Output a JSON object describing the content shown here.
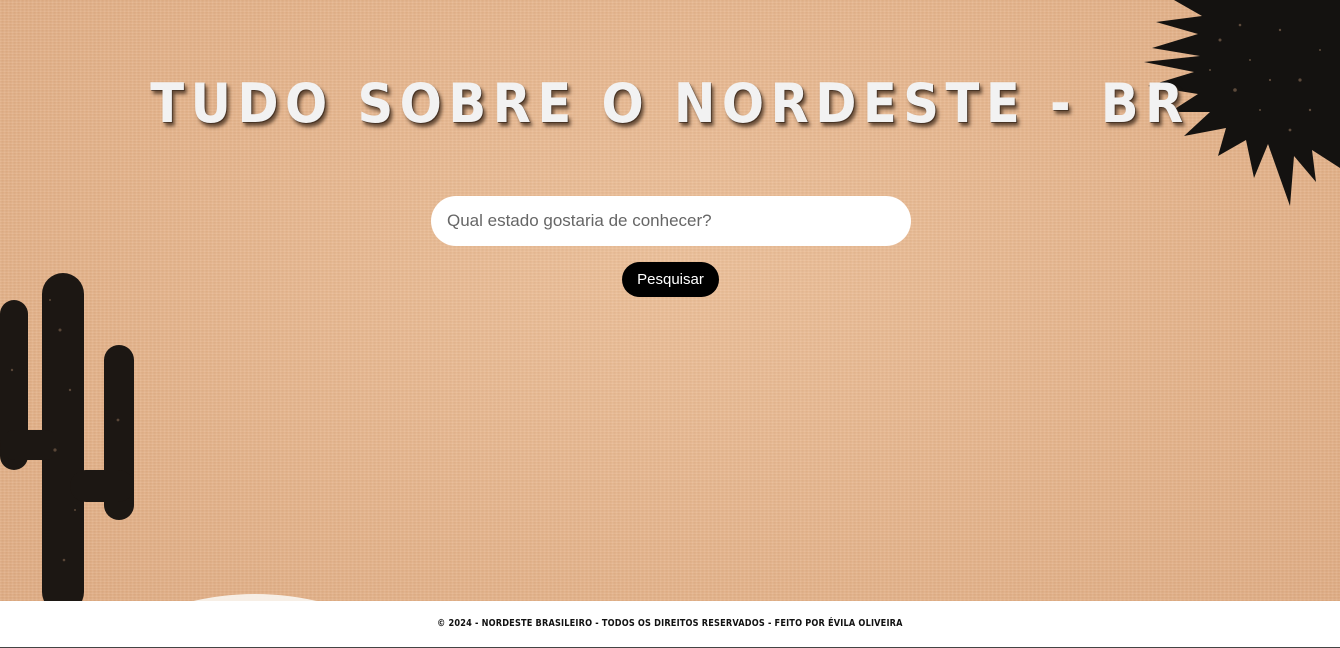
{
  "hero": {
    "title": "TUDO SOBRE O NORDESTE - BR"
  },
  "search": {
    "placeholder": "Qual estado gostaria de conhecer?",
    "value": "",
    "button_label": "Pesquisar"
  },
  "decorations": {
    "sun_icon": "sun-icon",
    "cactus_icon": "cactus-icon",
    "sun_color": "#141210",
    "cactus_color": "#1c1713"
  },
  "footer": {
    "text": "© 2024 - NORDESTE BRASILEIRO - TODOS OS DIREITOS RESERVADOS - FEITO POR ÉVILA OLIVEIRA"
  },
  "colors": {
    "background": "#e5b48c",
    "button": "#000000",
    "footer_bg": "#ffffff"
  }
}
